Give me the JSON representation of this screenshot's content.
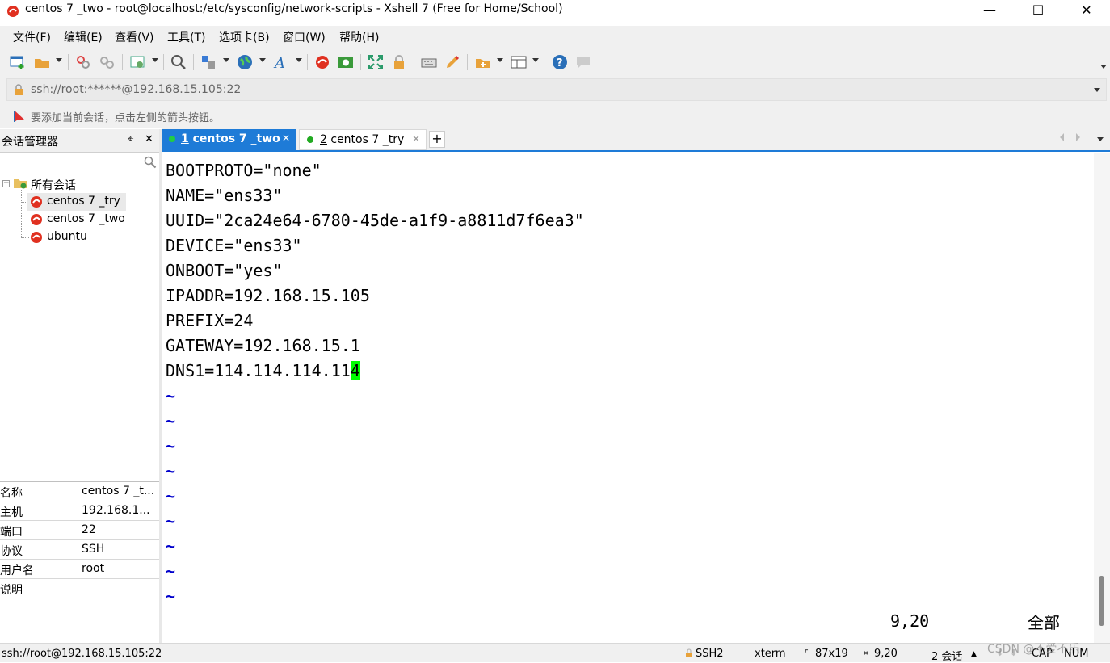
{
  "window": {
    "title": "centos 7 _two - root@localhost:/etc/sysconfig/network-scripts - Xshell 7 (Free for Home/School)",
    "minimize": "—",
    "maximize": "☐",
    "close": "✕"
  },
  "menu": [
    "文件(F)",
    "编辑(E)",
    "查看(V)",
    "工具(T)",
    "选项卡(B)",
    "窗口(W)",
    "帮助(H)"
  ],
  "address": {
    "value": "ssh://root:******@192.168.15.105:22"
  },
  "hint": "要添加当前会话，点击左侧的箭头按钮。",
  "session_manager": {
    "title": "会话管理器",
    "pin": "⌖",
    "close": "✕",
    "tree_root": "所有会话",
    "sessions": [
      "centos 7 _try",
      "centos 7 _two",
      "ubuntu"
    ]
  },
  "properties": [
    {
      "key": "名称",
      "value": "centos 7 _t..."
    },
    {
      "key": "主机",
      "value": "192.168.1..."
    },
    {
      "key": "端口",
      "value": "22"
    },
    {
      "key": "协议",
      "value": "SSH"
    },
    {
      "key": "用户名",
      "value": "root"
    },
    {
      "key": "说明",
      "value": ""
    }
  ],
  "tabs": [
    {
      "num": "1",
      "label": " centos 7 _two",
      "active": true
    },
    {
      "num": "2",
      "label": " centos 7 _try",
      "active": false
    }
  ],
  "terminal": {
    "lines": [
      "BOOTPROTO=\"none\"",
      "NAME=\"ens33\"",
      "UUID=\"2ca24e64-6780-45de-a1f9-a8811d7f6ea3\"",
      "DEVICE=\"ens33\"",
      "ONBOOT=\"yes\"",
      "IPADDR=192.168.15.105",
      "PREFIX=24",
      "GATEWAY=192.168.15.1",
      "DNS1=114.114.114.11"
    ],
    "cursor_char": "4",
    "tilde": "~",
    "position": "9,20",
    "scope": "全部"
  },
  "status": {
    "connection": "ssh://root@192.168.15.105:22",
    "protocol": "SSH2",
    "term": "xterm",
    "size": "87x19",
    "cursor": "9,20",
    "sessions": "2 会话",
    "cap": "CAP",
    "num": "NUM",
    "watermark": "CSDN @不爱不乐"
  },
  "colors": {
    "accent": "#1e7bd7",
    "cursor": "#00ff00",
    "tilde": "#0000cc",
    "session_icon": "#e03020",
    "tab_dot": "#22aa22"
  }
}
